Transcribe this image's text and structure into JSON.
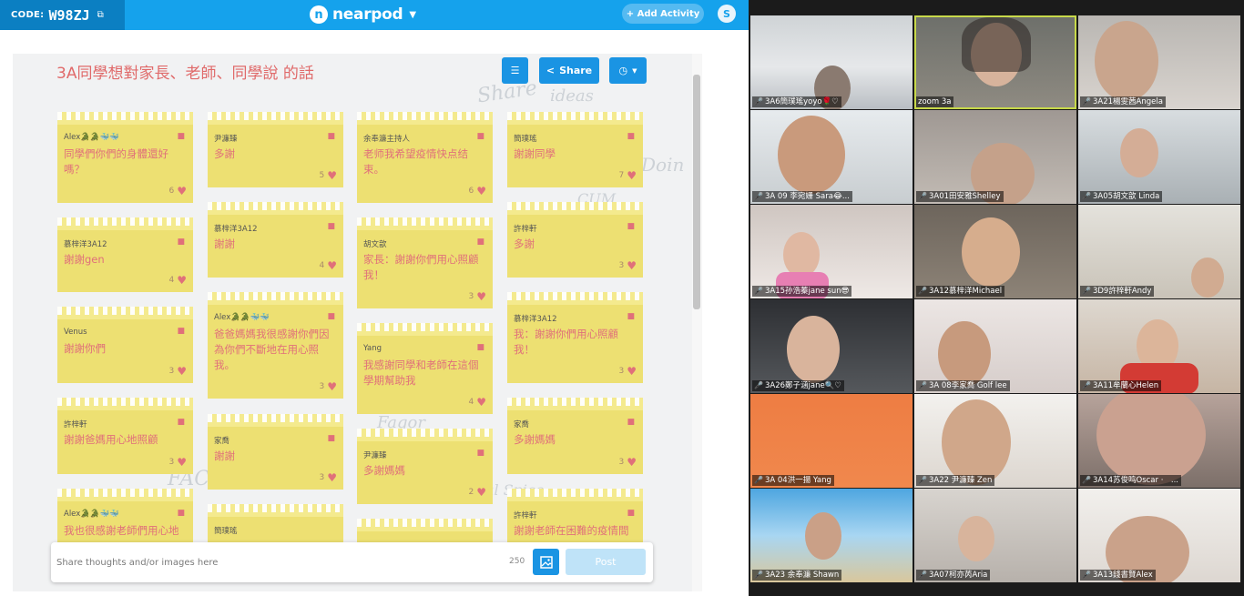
{
  "topbar": {
    "code_label": "CODE:",
    "code_value": "W98ZJ",
    "logo_text": "nearpod",
    "add_activity": "+ Add Activity",
    "avatar_letter": "S"
  },
  "board": {
    "title": "3A同學想對家長、老師、同學說 的話",
    "share_label": "Share"
  },
  "notes": [
    {
      "author": "Alex🐊🐊🐳🐳",
      "text": "同學們你們的身體還好嗎？",
      "likes": "6"
    },
    {
      "author": "尹濂臻",
      "text": "多謝",
      "likes": "5"
    },
    {
      "author": "余奉濂主持人",
      "text": "老师我希望疫情快点结束。",
      "likes": "6"
    },
    {
      "author": "簡璞瑤",
      "text": "謝謝同學",
      "likes": "7"
    },
    {
      "author": "慕梓洋3A12",
      "text": "謝謝gen",
      "likes": "4"
    },
    {
      "author": "慕梓洋3A12",
      "text": "謝謝",
      "likes": "4"
    },
    {
      "author": "胡文歆",
      "text": "家長：謝謝你們用心照顧我！",
      "likes": "3"
    },
    {
      "author": "許梓軒",
      "text": "多謝",
      "likes": "3"
    },
    {
      "author": "Venus",
      "text": "謝謝你們",
      "likes": "3"
    },
    {
      "author": "Alex🐊🐊🐳🐳",
      "text": "爸爸媽媽我很感謝你們因為你們不斷地在用心照我。",
      "likes": "3"
    },
    {
      "author": "Yang",
      "text": "我感謝同學和老師在這個學期幫助我",
      "likes": "4"
    },
    {
      "author": "慕梓洋3A12",
      "text": "我：謝謝你們用心照顧我！",
      "likes": "3"
    },
    {
      "author": "許梓軒",
      "text": "謝謝爸媽用心地照顧",
      "likes": "3"
    },
    {
      "author": "家喬",
      "text": "謝謝",
      "likes": "3"
    },
    {
      "author": "尹濂臻",
      "text": "多謝媽媽",
      "likes": "2"
    },
    {
      "author": "家喬",
      "text": "多謝媽媽",
      "likes": "3"
    },
    {
      "author": "Alex🐊🐊🐳🐳",
      "text": "我也很感謝老師們用心地",
      "likes": ""
    },
    {
      "author": "簡璞瑤",
      "text": "",
      "likes": ""
    },
    {
      "author": "",
      "text": "",
      "likes": ""
    },
    {
      "author": "許梓軒",
      "text": "謝謝老師在困難的疫情間",
      "likes": ""
    }
  ],
  "compose": {
    "placeholder": "Share thoughts and/or images here",
    "char_count": "250",
    "post_label": "Post"
  },
  "participants": [
    {
      "name": "3A6簡璞瑤yoyo🌹♡"
    },
    {
      "name": "zoom 3a"
    },
    {
      "name": "3A21楊雯茜Angela"
    },
    {
      "name": "3A 09 李宛姗 Sara😂..."
    },
    {
      "name": "3A01田安雅Shelley"
    },
    {
      "name": "3A05胡文歆 Linda"
    },
    {
      "name": "3A15孙浩蓁jane sun😎"
    },
    {
      "name": "3A12慕梓洋Michael"
    },
    {
      "name": "3D9許梓軒Andy"
    },
    {
      "name": "3A26鄭子涵jane🔍♡"
    },
    {
      "name": "3A 08李家喬 Golf lee"
    },
    {
      "name": "3A11牟蘭心Helen"
    },
    {
      "name": "3A 04洪一揚 Yang"
    },
    {
      "name": "3A22 尹濂臻 Zen"
    },
    {
      "name": "3A14苏俊鸣Oscar ·　..."
    },
    {
      "name": "3A23 余奉濂 Shawn"
    },
    {
      "name": "3A07柯亦芮Aria"
    },
    {
      "name": "3A13錢書賢Alex"
    }
  ]
}
